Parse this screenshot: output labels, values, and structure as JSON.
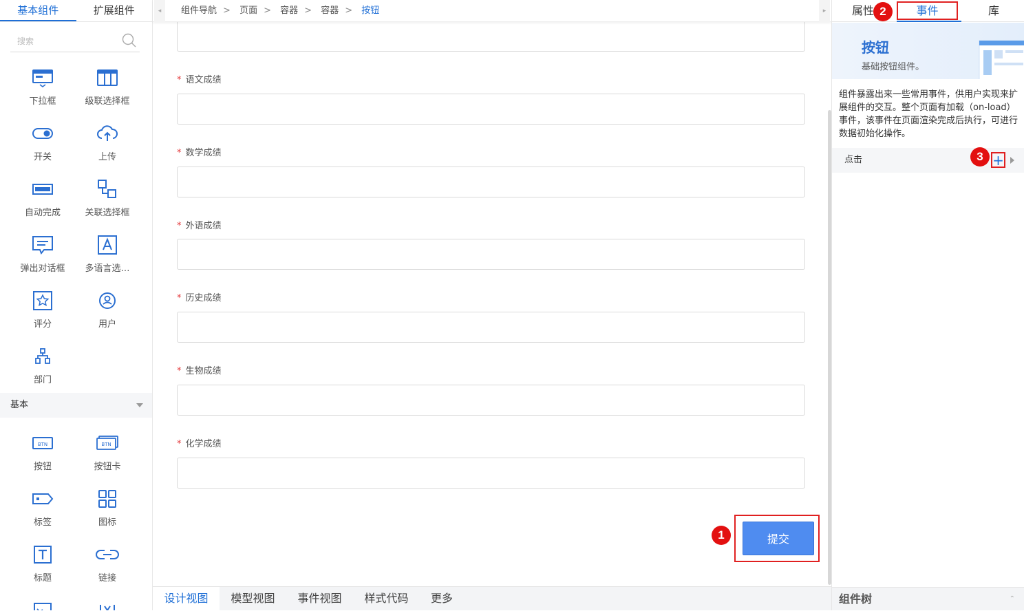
{
  "left_panel": {
    "tabs": [
      "基本组件",
      "扩展组件"
    ],
    "search_placeholder": "搜索",
    "components_top": [
      {
        "label": "下拉框",
        "icon": "dropdown-icon"
      },
      {
        "label": "级联选择框",
        "icon": "cascader-icon"
      },
      {
        "label": "开关",
        "icon": "switch-icon"
      },
      {
        "label": "上传",
        "icon": "upload-icon"
      },
      {
        "label": "自动完成",
        "icon": "autocomplete-icon"
      },
      {
        "label": "关联选择框",
        "icon": "relation-select-icon"
      },
      {
        "label": "弹出对话框",
        "icon": "dialog-icon"
      },
      {
        "label": "多语言选…",
        "icon": "multilang-icon"
      },
      {
        "label": "评分",
        "icon": "rating-icon"
      },
      {
        "label": "用户",
        "icon": "user-icon"
      },
      {
        "label": "部门",
        "icon": "department-icon"
      }
    ],
    "section_title": "基本",
    "components_basic": [
      {
        "label": "按钮",
        "icon": "button-icon"
      },
      {
        "label": "按钮卡",
        "icon": "button-card-icon"
      },
      {
        "label": "标签",
        "icon": "tag-icon"
      },
      {
        "label": "图标",
        "icon": "icon-icon"
      },
      {
        "label": "标题",
        "icon": "title-icon"
      },
      {
        "label": "链接",
        "icon": "link-icon"
      }
    ]
  },
  "breadcrumb": [
    "组件导航",
    "页面",
    "容器",
    "容器",
    "按钮"
  ],
  "form": {
    "fields": [
      {
        "label": "语文成绩",
        "required": true,
        "value": ""
      },
      {
        "label": "数学成绩",
        "required": true,
        "value": ""
      },
      {
        "label": "外语成绩",
        "required": true,
        "value": ""
      },
      {
        "label": "历史成绩",
        "required": true,
        "value": ""
      },
      {
        "label": "生物成绩",
        "required": true,
        "value": ""
      },
      {
        "label": "化学成绩",
        "required": true,
        "value": ""
      }
    ],
    "submit_label": "提交",
    "required_mark": "*"
  },
  "annotations": {
    "b1": "1",
    "b2": "2",
    "b3": "3"
  },
  "bottom_tabs": [
    "设计视图",
    "模型视图",
    "事件视图",
    "样式代码",
    "更多"
  ],
  "right_panel": {
    "tabs": [
      "属性",
      "事件",
      "库"
    ],
    "component_title": "按钮",
    "component_subtitle": "基础按钮组件。",
    "description": "组件暴露出来一些常用事件，供用户实现来扩展组件的交互。整个页面有加载（on-load）事件，该事件在页面渲染完成后执行，可进行数据初始化操作。",
    "event_label": "点击",
    "add_symbol": "+",
    "tree_title": "组件树"
  },
  "colors": {
    "accent": "#1f6fd6",
    "highlight": "#e02020",
    "submit": "#4f8cf0"
  }
}
